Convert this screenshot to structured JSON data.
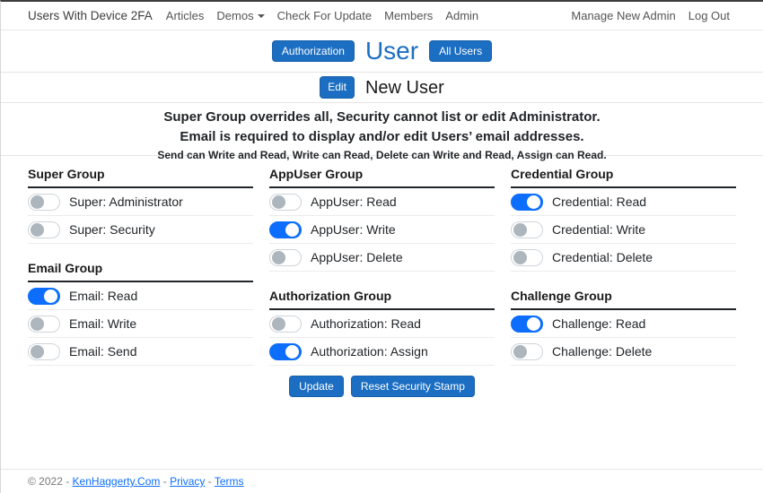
{
  "colors": {
    "accent": "#1b6ec2",
    "toggle_on": "#0d6efd",
    "link": "#0d6efd"
  },
  "navbar": {
    "brand": "Users With Device 2FA",
    "links": [
      {
        "label": "Articles",
        "dropdown": false
      },
      {
        "label": "Demos",
        "dropdown": true
      },
      {
        "label": "Check For Update",
        "dropdown": false
      },
      {
        "label": "Members",
        "dropdown": false
      },
      {
        "label": "Admin",
        "dropdown": false
      }
    ],
    "right_links": [
      {
        "label": "Manage New Admin"
      },
      {
        "label": "Log Out"
      }
    ]
  },
  "header": {
    "authorization_button": "Authorization",
    "title": "User",
    "all_users_button": "All Users",
    "edit_button": "Edit",
    "subtitle": "New User"
  },
  "notes": {
    "line1": "Super Group overrides all, Security cannot list or edit Administrator.",
    "line2": "Email is required to display and/or edit Users’ email addresses.",
    "line3": "Send can Write and Read, Write can Read, Delete can Write and Read, Assign can Read."
  },
  "permission_columns": [
    {
      "groups": [
        {
          "title": "Super Group",
          "items": [
            {
              "label": "Super: Administrator",
              "on": false
            },
            {
              "label": "Super: Security",
              "on": false
            }
          ]
        },
        {
          "title": "Email Group",
          "items": [
            {
              "label": "Email: Read",
              "on": true
            },
            {
              "label": "Email: Write",
              "on": false
            },
            {
              "label": "Email: Send",
              "on": false
            }
          ]
        }
      ]
    },
    {
      "groups": [
        {
          "title": "AppUser Group",
          "items": [
            {
              "label": "AppUser: Read",
              "on": false
            },
            {
              "label": "AppUser: Write",
              "on": true
            },
            {
              "label": "AppUser: Delete",
              "on": false
            }
          ]
        },
        {
          "title": "Authorization Group",
          "items": [
            {
              "label": "Authorization: Read",
              "on": false
            },
            {
              "label": "Authorization: Assign",
              "on": true
            }
          ]
        }
      ]
    },
    {
      "groups": [
        {
          "title": "Credential Group",
          "items": [
            {
              "label": "Credential: Read",
              "on": true
            },
            {
              "label": "Credential: Write",
              "on": false
            },
            {
              "label": "Credential: Delete",
              "on": false
            }
          ]
        },
        {
          "title": "Challenge Group",
          "items": [
            {
              "label": "Challenge: Read",
              "on": true
            },
            {
              "label": "Challenge: Delete",
              "on": false
            }
          ]
        }
      ]
    }
  ],
  "actions": {
    "update_label": "Update",
    "reset_label": "Reset Security Stamp"
  },
  "footer": {
    "prefix": "© 2022 -",
    "separator": "-",
    "links": [
      {
        "label": "KenHaggerty.Com"
      },
      {
        "label": "Privacy"
      },
      {
        "label": "Terms"
      }
    ]
  }
}
